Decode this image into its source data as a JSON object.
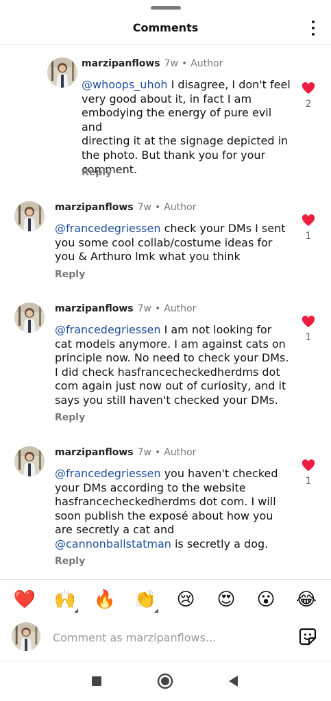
{
  "header": {
    "title": "Comments",
    "menu_icon": "more-vertical-icon"
  },
  "comments": [
    {
      "username": "marzipanflows",
      "time": "7w",
      "separator": "•",
      "role": "Author",
      "mention": "@whoops_uhoh",
      "lines": [
        "@whoops_uhoh I disagree, I don't feel",
        "very good about it, in fact I am",
        "embodying the energy of pure evil and",
        "directing it at the signage depicted in",
        "the photo. But thank you for your",
        "comment."
      ],
      "reply_label": "Reply",
      "likes": "2"
    },
    {
      "username": "marzipanflows",
      "time": "7w",
      "separator": "•",
      "role": "Author",
      "mention": "@francedegriessen",
      "lines": [
        "@francedegriessen check your DMs I sent",
        "you some cool collab/costume ideas for",
        "you & Arthuro lmk what you think"
      ],
      "reply_label": "Reply",
      "likes": "1"
    },
    {
      "username": "marzipanflows",
      "time": "7w",
      "separator": "•",
      "role": "Author",
      "mention": "@francedegriessen",
      "lines": [
        "@francedegriessen I am not looking for",
        "cat models anymore. I am against cats on",
        "principle now. No need to check your DMs.",
        "I did check hasfrancecheckedherdms dot",
        "com again just now out of curiosity, and it",
        "says you still haven't checked your DMs."
      ],
      "reply_label": "Reply",
      "likes": "1"
    },
    {
      "username": "marzipanflows",
      "time": "7w",
      "separator": "•",
      "role": "Author",
      "mention": "@francedegriessen",
      "second_mention": "@cannonballstatman",
      "lines": [
        "@francedegriessen you haven't checked",
        "your DMs according to the website",
        "hasfrancecheckedherdms dot com. I will",
        "soon publish the exposé about how you",
        "are secretly a cat and",
        "@cannonballstatman is secretly a dog."
      ],
      "reply_label": "Reply",
      "likes": "1"
    }
  ],
  "reactions": [
    {
      "emoji": "❤️",
      "name": "red-heart"
    },
    {
      "emoji": "🙌",
      "name": "raising-hands",
      "has_variants": true
    },
    {
      "emoji": "🔥",
      "name": "fire"
    },
    {
      "emoji": "👏",
      "name": "clapping-hands",
      "has_variants": true
    },
    {
      "emoji": "😢",
      "name": "crying-face"
    },
    {
      "emoji": "😍",
      "name": "heart-eyes"
    },
    {
      "emoji": "😮",
      "name": "surprised-face"
    },
    {
      "emoji": "😂",
      "name": "tears-of-joy"
    }
  ],
  "composer": {
    "placeholder": "Comment as marzipanflows...",
    "sticker_icon": "sticker-icon"
  },
  "system_nav": {
    "icons": [
      "recents-square-icon",
      "home-circle-icon",
      "back-triangle-icon"
    ]
  },
  "colors": {
    "like_red": "#ee1d3f",
    "mention_blue": "#1e4f9c",
    "secondary_gray": "#777777"
  }
}
